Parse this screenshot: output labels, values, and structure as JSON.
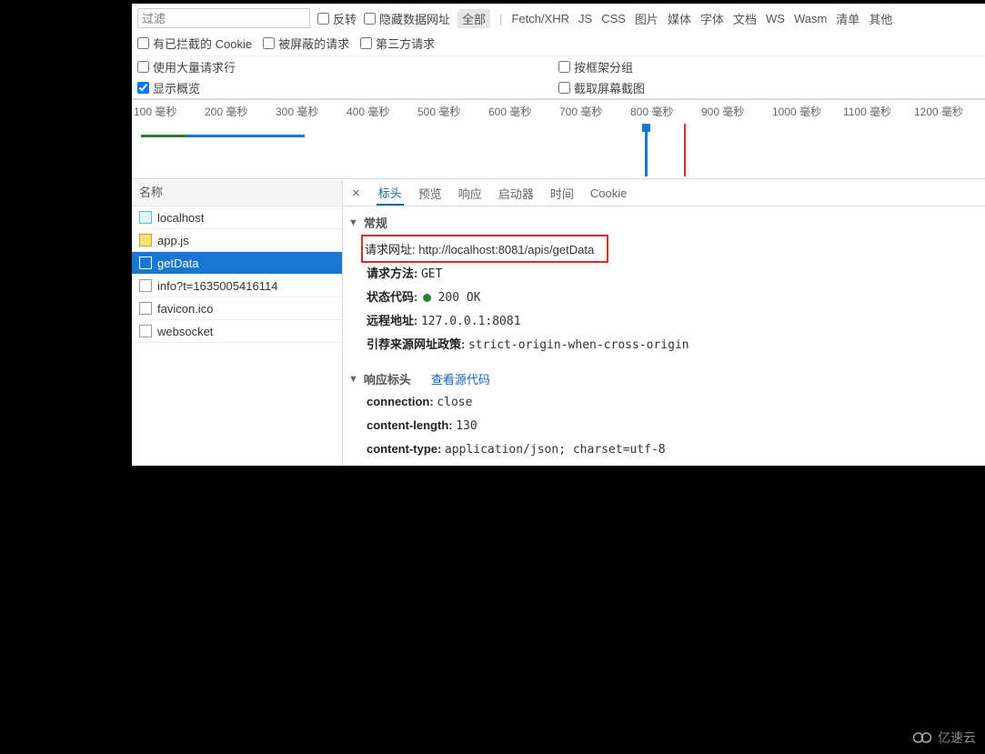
{
  "toolbar": {
    "filter_placeholder": "过滤",
    "invert": "反转",
    "hide_data_urls": "隐藏数据网址",
    "types": {
      "all": "全部",
      "fetch_xhr": "Fetch/XHR",
      "js": "JS",
      "css": "CSS",
      "img": "图片",
      "media": "媒体",
      "font": "字体",
      "doc": "文档",
      "ws": "WS",
      "wasm": "Wasm",
      "manifest": "清单",
      "other": "其他"
    },
    "blocked_cookies": "有已拦截的 Cookie",
    "blocked_requests": "被屏蔽的请求",
    "third_party": "第三方请求",
    "large_rows": "使用大量请求行",
    "group_by_frame": "按框架分组",
    "show_overview": "显示概览",
    "capture_screenshot": "截取屏幕截图"
  },
  "timeline": {
    "ticks": [
      "100 毫秒",
      "200 毫秒",
      "300 毫秒",
      "400 毫秒",
      "500 毫秒",
      "600 毫秒",
      "700 毫秒",
      "800 毫秒",
      "900 毫秒",
      "1000 毫秒",
      "1100 毫秒",
      "1200 毫秒"
    ]
  },
  "left": {
    "header": "名称",
    "items": [
      {
        "name": "localhost",
        "icon": "html"
      },
      {
        "name": "app.js",
        "icon": "js"
      },
      {
        "name": "getData",
        "icon": "none",
        "selected": true
      },
      {
        "name": "info?t=1635005416114",
        "icon": "none"
      },
      {
        "name": "favicon.ico",
        "icon": "none"
      },
      {
        "name": "websocket",
        "icon": "none"
      }
    ]
  },
  "detail_tabs": {
    "headers": "标头",
    "preview": "预览",
    "response": "响应",
    "initiator": "启动器",
    "timing": "时间",
    "cookies": "Cookie"
  },
  "sections": {
    "general": {
      "title": "常规",
      "request_url_label": "请求网址:",
      "request_url_value": "http://localhost:8081/apis/getData",
      "method_label": "请求方法:",
      "method_value": "GET",
      "status_label": "状态代码:",
      "status_value": "200 OK",
      "remote_label": "远程地址:",
      "remote_value": "127.0.0.1:8081",
      "referrer_label": "引荐来源网址政策:",
      "referrer_value": "strict-origin-when-cross-origin"
    },
    "response_headers": {
      "title": "响应标头",
      "view_source": "查看源代码",
      "items": [
        {
          "k": "connection:",
          "v": "close"
        },
        {
          "k": "content-length:",
          "v": "130"
        },
        {
          "k": "content-type:",
          "v": "application/json; charset=utf-8"
        }
      ]
    }
  },
  "watermark": "亿速云"
}
